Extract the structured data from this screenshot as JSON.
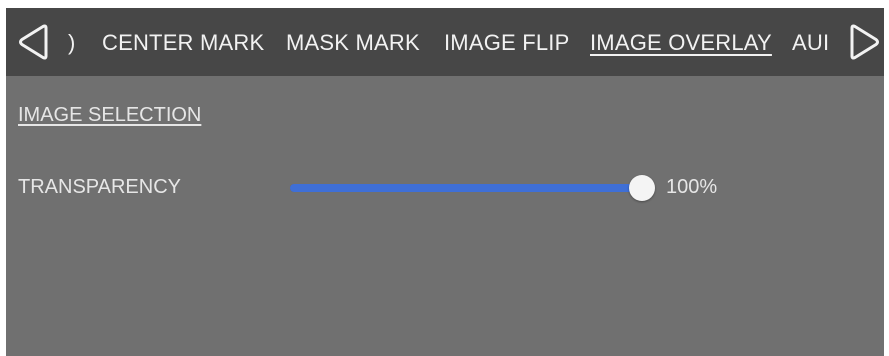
{
  "nav": {
    "tabs": [
      {
        "label": "CENTER MARK",
        "active": false
      },
      {
        "label": "MASK MARK",
        "active": false
      },
      {
        "label": "IMAGE FLIP",
        "active": false
      },
      {
        "label": "IMAGE OVERLAY",
        "active": true
      }
    ],
    "partial_left": ")",
    "partial_right": "AUΙ",
    "prev_icon": "left-triangle-arrow",
    "next_icon": "right-triangle-arrow"
  },
  "panel": {
    "image_selection_label": "IMAGE SELECTION",
    "transparency": {
      "label": "TRANSPARENCY",
      "value_text": "100%",
      "value_percent": 100
    }
  },
  "colors": {
    "top_bar": "#474747",
    "panel_background": "#707070",
    "slider_fill": "#3f6fd6",
    "slider_thumb": "#f4f4f4",
    "text": "#e6e6e6"
  }
}
